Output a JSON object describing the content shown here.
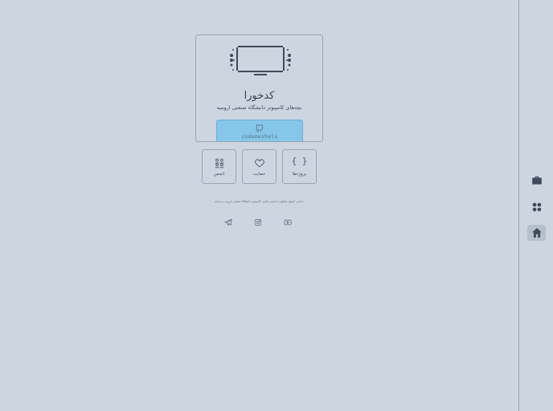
{
  "card": {
    "title": "کدخورا",
    "subtitle": "بچه‌های کامپیوتر دانشگاه صنعتی ارومیه",
    "github_button": {
      "icon": "github-icon",
      "text": "codemeshels"
    }
  },
  "tiles": [
    {
      "label": "پروژه‌ها",
      "icon": "code-braces-icon",
      "glyph": "{ }"
    },
    {
      "label": "حمایت",
      "icon": "heart-icon"
    },
    {
      "label": "انجمن",
      "icon": "community-icon"
    }
  ],
  "footer": {
    "text": "تمامی حقوق متعلق به انجمن علمی کامپیوتر دانشگاه صنعتی ارومیه می‌باشد."
  },
  "social": [
    "telegram-icon",
    "instagram-icon",
    "youtube-icon"
  ],
  "sidebar": {
    "items": [
      {
        "icon": "briefcase-icon",
        "active": false
      },
      {
        "icon": "apps-grid-icon",
        "active": false
      },
      {
        "icon": "home-icon",
        "active": true
      }
    ]
  },
  "colors": {
    "background": "#ccd5e0",
    "border": "#9aa5b3",
    "accent": "#86c6e8",
    "icon": "#3f4a5a"
  }
}
